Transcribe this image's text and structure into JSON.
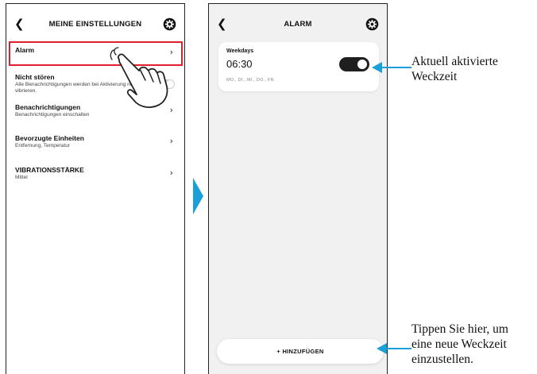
{
  "settings": {
    "title": "MEINE EINSTELLUNGEN",
    "items": [
      {
        "label": "Alarm",
        "sub": ""
      },
      {
        "label": "Nicht stören",
        "sub": "Alle Benachrichtigungen werden bei Aktivierung nicht vibrieren."
      },
      {
        "label": "Benachrichtigungen",
        "sub": "Benachrichtigungen einschalten"
      },
      {
        "label": "Bevorzugte Einheiten",
        "sub": "Entfernung, Temperatur"
      },
      {
        "label": "VIBRATIONSSTÄRKE",
        "sub": "Mittel"
      }
    ]
  },
  "alarm": {
    "title": "ALARM",
    "card": {
      "label": "Weekdays",
      "time": "06:30",
      "days": "MO., DI., MI., DO., FR.",
      "enabled": true
    },
    "add_label": "HINZUFÜGEN",
    "add_icon": "+"
  },
  "annotations": {
    "active": [
      "Aktuell aktivierte",
      "Weckzeit"
    ],
    "add": [
      "Tippen Sie hier, um",
      "eine neue Weckzeit",
      "einzustellen."
    ]
  },
  "colors": {
    "highlight": "#e0202e",
    "arrow": "#1a9fd9"
  },
  "icons": {
    "back": "chevron-left-icon",
    "settings": "gear-icon",
    "next": "chevron-right-icon"
  }
}
